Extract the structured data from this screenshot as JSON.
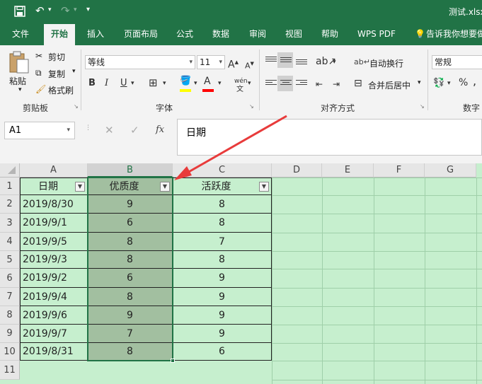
{
  "titlebar": {
    "filename": "测试.xlsx"
  },
  "tabs": [
    "文件",
    "开始",
    "插入",
    "页面布局",
    "公式",
    "数据",
    "审阅",
    "视图",
    "帮助",
    "WPS PDF"
  ],
  "tell_me": "告诉我你想要做",
  "clipboard": {
    "paste": "粘贴",
    "cut": "剪切",
    "copy": "复制",
    "format_painter": "格式刷",
    "group": "剪贴板"
  },
  "font": {
    "name": "等线",
    "size": "11",
    "grow": "A",
    "shrink": "A",
    "bold": "B",
    "italic": "I",
    "underline": "U",
    "color_letter": "A",
    "wen": "wén",
    "group": "字体"
  },
  "alignment": {
    "wrap": "自动换行",
    "merge": "合并后居中",
    "group": "对齐方式"
  },
  "number": {
    "format": "常规",
    "percent": "%",
    "comma": ",",
    "group": "数字"
  },
  "formula_bar": {
    "name_box": "A1",
    "fx": "fx",
    "content": "日期"
  },
  "columns": [
    "A",
    "B",
    "C",
    "D",
    "E",
    "F",
    "G"
  ],
  "rows": [
    "1",
    "2",
    "3",
    "4",
    "5",
    "6",
    "7",
    "8",
    "9",
    "10",
    "11"
  ],
  "table": {
    "headers": [
      "日期",
      "优质度",
      "活跃度"
    ],
    "rows": [
      [
        "2019/8/30",
        "9",
        "8"
      ],
      [
        "2019/9/1",
        "6",
        "8"
      ],
      [
        "2019/9/5",
        "8",
        "7"
      ],
      [
        "2019/9/3",
        "8",
        "8"
      ],
      [
        "2019/9/2",
        "6",
        "9"
      ],
      [
        "2019/9/4",
        "8",
        "9"
      ],
      [
        "2019/9/6",
        "9",
        "9"
      ],
      [
        "2019/9/7",
        "7",
        "9"
      ],
      [
        "2019/8/31",
        "8",
        "6"
      ]
    ]
  },
  "colors": {
    "excel_green": "#217346",
    "sheet_bg": "#c6efce",
    "selection": "#a2bfa0",
    "arrow": "#e83b3b"
  }
}
